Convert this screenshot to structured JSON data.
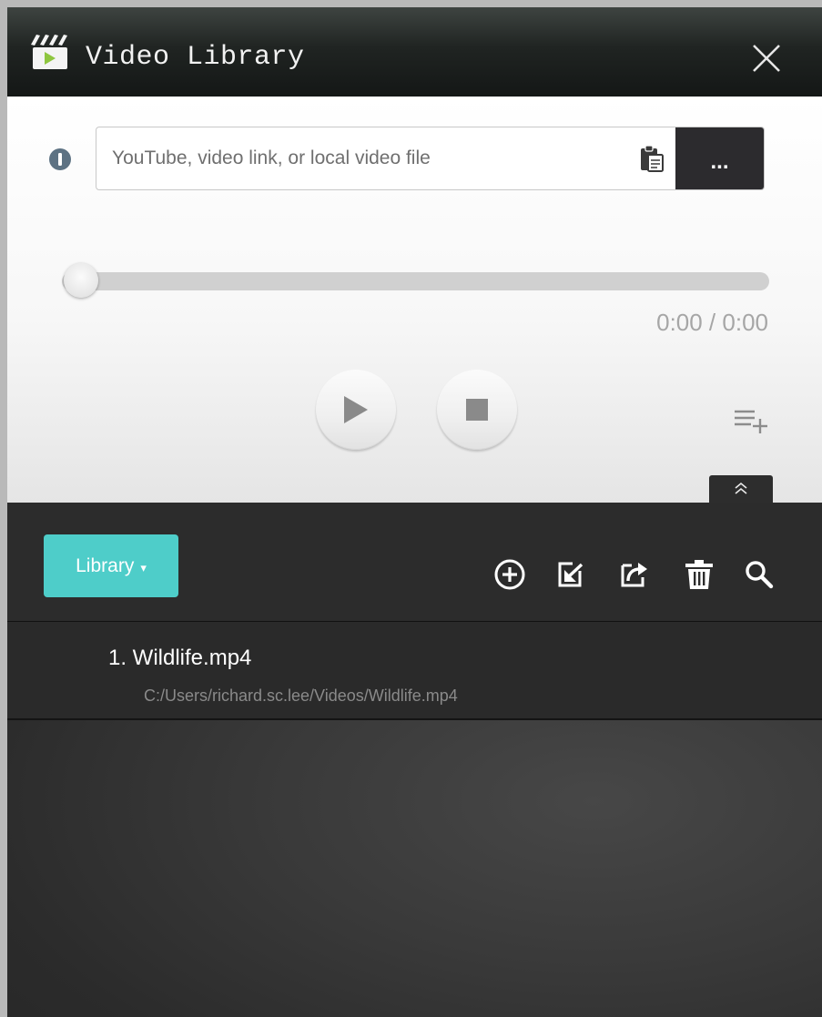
{
  "window": {
    "title": "Video Library"
  },
  "player": {
    "url_placeholder": "YouTube, video link, or local video file",
    "browse_label": "...",
    "time": "0:00 / 0:00",
    "progress": 0
  },
  "library": {
    "menu_label": "Library",
    "menu_caret": "▾",
    "items": [
      {
        "title": "1. Wildlife.mp4",
        "path": "C:/Users/richard.sc.lee/Videos/Wildlife.mp4"
      }
    ]
  },
  "colors": {
    "accent": "#4ecdc9",
    "titlebar": "#202422",
    "library_bg": "#2c2c2c"
  },
  "icons": {
    "app": "clapperboard-play-icon",
    "close": "close-icon",
    "info": "info-icon",
    "paste": "clipboard-icon",
    "play": "play-icon",
    "stop": "stop-icon",
    "add_to_playlist": "playlist-add-icon",
    "collapse": "chevron-double-up-icon",
    "add": "plus-circle-icon",
    "import": "import-icon",
    "export": "share-icon",
    "delete": "trash-icon",
    "search": "search-icon"
  }
}
